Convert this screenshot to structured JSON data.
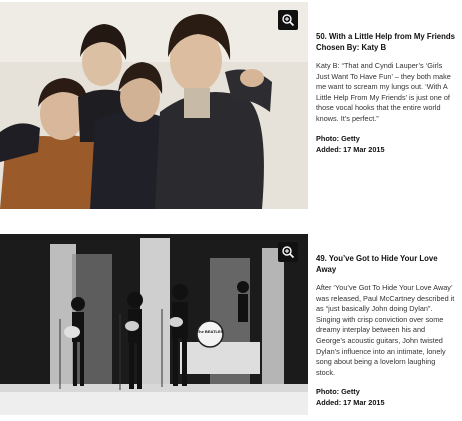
{
  "entries": [
    {
      "rank_title": "50. With a Little Help from My Friends",
      "chosen_by": "Chosen By: Katy B",
      "description": "Katy B: “That and Cyndi Lauper’s ‘Girls Just Want To Have Fun’ – they both make me want to scream my lungs out. ‘With A Little Help From My Friends’ is just one of those vocal hooks that the entire world knows. It’s perfect.”",
      "photo_credit": "Photo: Getty",
      "added": "Added: 17 Mar 2015",
      "zoom_icon": "zoom-in-icon"
    },
    {
      "rank_title": "49. You’ve Got to Hide Your Love Away",
      "description": "After ‘You’ve Got To Hide Your Love Away’ was released, Paul McCartney described it as “just basically John doing Dylan”. Singing with crisp conviction over some dreamy interplay between his and George’s acoustic guitars, John twisted Dylan’s influence into an intimate, lonely song about being a lovelorn laughing stock.",
      "photo_credit": "Photo: Getty",
      "added": "Added: 17 Mar 2015",
      "zoom_icon": "zoom-in-icon",
      "drum_text": "The BEATLES"
    }
  ],
  "colors": {
    "photo1_bg": "#e8e4dc",
    "photo2_bg": "#1a1a1a",
    "zoom_bg": "#111111"
  }
}
